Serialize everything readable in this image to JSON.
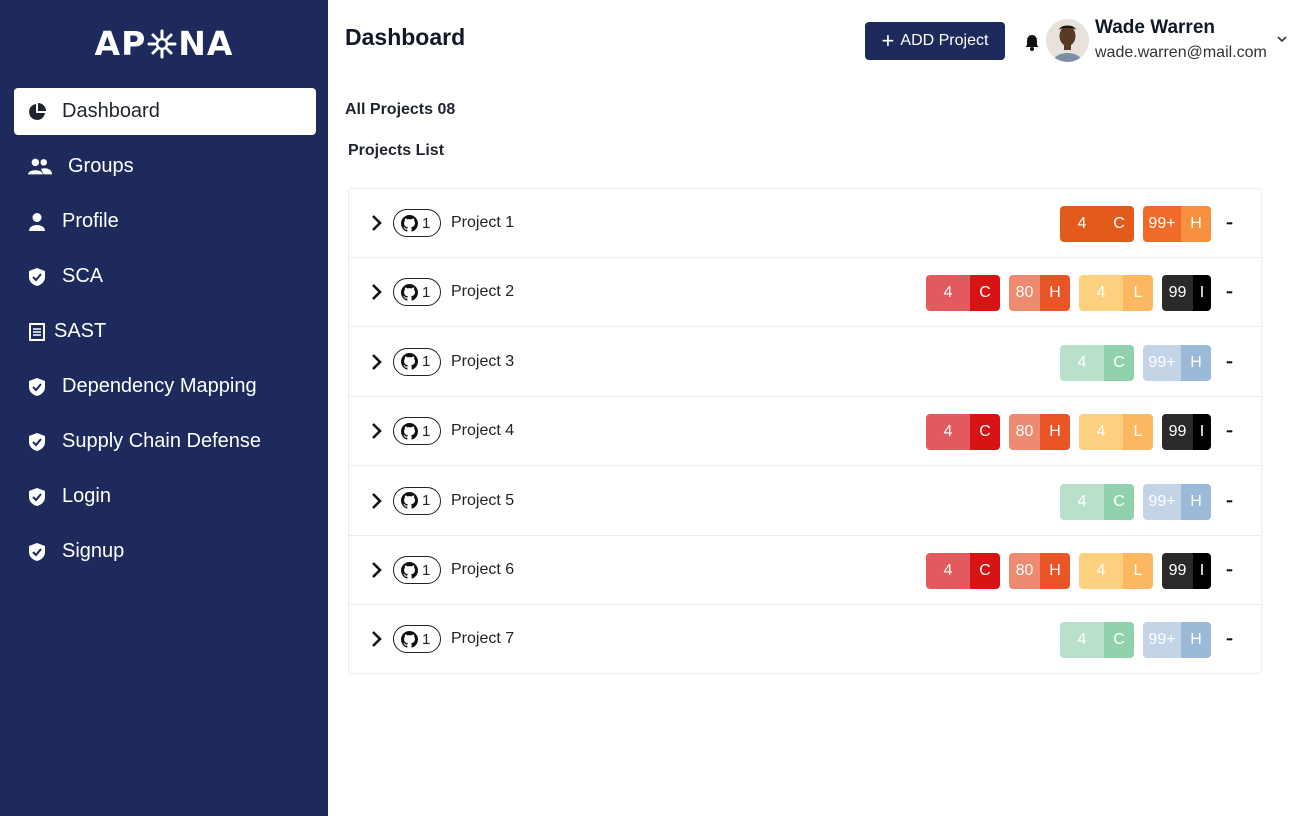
{
  "app": {
    "logo_text_left": "AP",
    "logo_text_right": "NA"
  },
  "sidebar": {
    "items": [
      {
        "label": "Dashboard",
        "icon": "pie-chart-icon",
        "active": true
      },
      {
        "label": "Groups",
        "icon": "users-icon"
      },
      {
        "label": "Profile",
        "icon": "user-icon"
      },
      {
        "label": "SCA",
        "icon": "shield-icon"
      },
      {
        "label": "SAST",
        "icon": "document-icon"
      },
      {
        "label": "Dependency Mapping",
        "icon": "shield-icon"
      },
      {
        "label": "Supply Chain Defense",
        "icon": "shield-icon"
      },
      {
        "label": "Login",
        "icon": "shield-icon"
      },
      {
        "label": "Signup",
        "icon": "shield-icon"
      }
    ]
  },
  "header": {
    "title": "Dashboard",
    "add_button": "ADD Project",
    "user": {
      "name": "Wade Warren",
      "email": "wade.warren@mail.com"
    }
  },
  "main": {
    "all_projects": "All Projects 08",
    "list_title": "Projects List",
    "projects": [
      {
        "name": "Project 1",
        "repos": "1",
        "badges": [
          {
            "count": "4",
            "level": "C",
            "count_bg": "#e35b1b",
            "level_bg": "#e35b1b"
          },
          {
            "count": "99+",
            "level": "H",
            "count_bg": "#f06b2a",
            "level_bg": "#f7913f"
          }
        ]
      },
      {
        "name": "Project 2",
        "repos": "1",
        "badges": [
          {
            "count": "4",
            "level": "C",
            "count_bg": "#e05a5e",
            "level_bg": "#d71313"
          },
          {
            "count": "80",
            "level": "H",
            "count_bg": "#ee8a6f",
            "level_bg": "#ea5527"
          },
          {
            "count": "4",
            "level": "L",
            "count_bg": "#fcd07e",
            "level_bg": "#fbb861"
          },
          {
            "count": "99",
            "level": "I",
            "count_bg": "#2a2a2a",
            "level_bg": "#000000"
          }
        ]
      },
      {
        "name": "Project 3",
        "repos": "1",
        "badges": [
          {
            "count": "4",
            "level": "C",
            "count_bg": "#b8e0cb",
            "level_bg": "#8fd2ad"
          },
          {
            "count": "99+",
            "level": "H",
            "count_bg": "#c4d4e7",
            "level_bg": "#9bbad9"
          }
        ]
      },
      {
        "name": "Project 4",
        "repos": "1",
        "badges": [
          {
            "count": "4",
            "level": "C",
            "count_bg": "#e05a5e",
            "level_bg": "#d71313"
          },
          {
            "count": "80",
            "level": "H",
            "count_bg": "#ee8a6f",
            "level_bg": "#ea5527"
          },
          {
            "count": "4",
            "level": "L",
            "count_bg": "#fcd07e",
            "level_bg": "#fbb861"
          },
          {
            "count": "99",
            "level": "I",
            "count_bg": "#2a2a2a",
            "level_bg": "#000000"
          }
        ]
      },
      {
        "name": "Project 5",
        "repos": "1",
        "badges": [
          {
            "count": "4",
            "level": "C",
            "count_bg": "#b8e0cb",
            "level_bg": "#8fd2ad"
          },
          {
            "count": "99+",
            "level": "H",
            "count_bg": "#c4d4e7",
            "level_bg": "#9bbad9"
          }
        ]
      },
      {
        "name": "Project 6",
        "repos": "1",
        "badges": [
          {
            "count": "4",
            "level": "C",
            "count_bg": "#e05a5e",
            "level_bg": "#d71313"
          },
          {
            "count": "80",
            "level": "H",
            "count_bg": "#ee8a6f",
            "level_bg": "#ea5527"
          },
          {
            "count": "4",
            "level": "L",
            "count_bg": "#fcd07e",
            "level_bg": "#fbb861"
          },
          {
            "count": "99",
            "level": "I",
            "count_bg": "#2a2a2a",
            "level_bg": "#000000"
          }
        ]
      },
      {
        "name": "Project 7",
        "repos": "1",
        "badges": [
          {
            "count": "4",
            "level": "C",
            "count_bg": "#b8e0cb",
            "level_bg": "#8fd2ad"
          },
          {
            "count": "99+",
            "level": "H",
            "count_bg": "#c4d4e7",
            "level_bg": "#9bbad9"
          }
        ]
      }
    ]
  },
  "colors": {
    "sidebar_bg": "#1f2a5c",
    "primary_button": "#1f2a5c"
  }
}
